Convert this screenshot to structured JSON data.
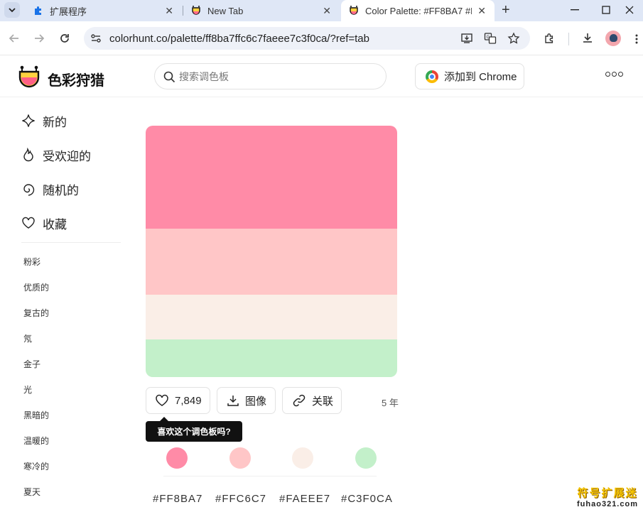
{
  "browser": {
    "tabs": [
      {
        "title": "扩展程序",
        "icon": "puzzle-icon"
      },
      {
        "title": "New Tab",
        "icon": "colorhunt-icon"
      },
      {
        "title": "Color Palette: #FF8BA7 #F",
        "icon": "colorhunt-icon",
        "active": true
      }
    ],
    "url": "colorhunt.co/palette/ff8ba7ffc6c7faeee7c3f0ca/?ref=tab"
  },
  "header": {
    "logo_text": "色彩狩猎",
    "search_placeholder": "搜索调色板",
    "chrome_button_label": "添加到 Chrome"
  },
  "sidebar": {
    "main_items": [
      {
        "label": "新的",
        "icon": "sparkle-icon"
      },
      {
        "label": "受欢迎的",
        "icon": "flame-icon"
      },
      {
        "label": "随机的",
        "icon": "spiral-icon"
      },
      {
        "label": "收藏",
        "icon": "heart-icon"
      }
    ],
    "tags": [
      "粉彩",
      "优质的",
      "复古的",
      "氖",
      "金子",
      "光",
      "黑暗的",
      "温暖的",
      "寒冷的",
      "夏天"
    ]
  },
  "palette": {
    "colors": [
      "#FF8BA7",
      "#FFC6C7",
      "#FAEEE7",
      "#C3F0CA"
    ],
    "hex_labels": [
      "#FF8BA7",
      "#FFC6C7",
      "#FAEEE7",
      "#C3F0CA"
    ],
    "likes": "7,849",
    "image_label": "图像",
    "link_label": "关联",
    "age": "5 年",
    "tooltip": "喜欢这个调色板吗?"
  },
  "watermark": {
    "line1": "符号扩展迷",
    "line2": "fuhao321.com"
  }
}
